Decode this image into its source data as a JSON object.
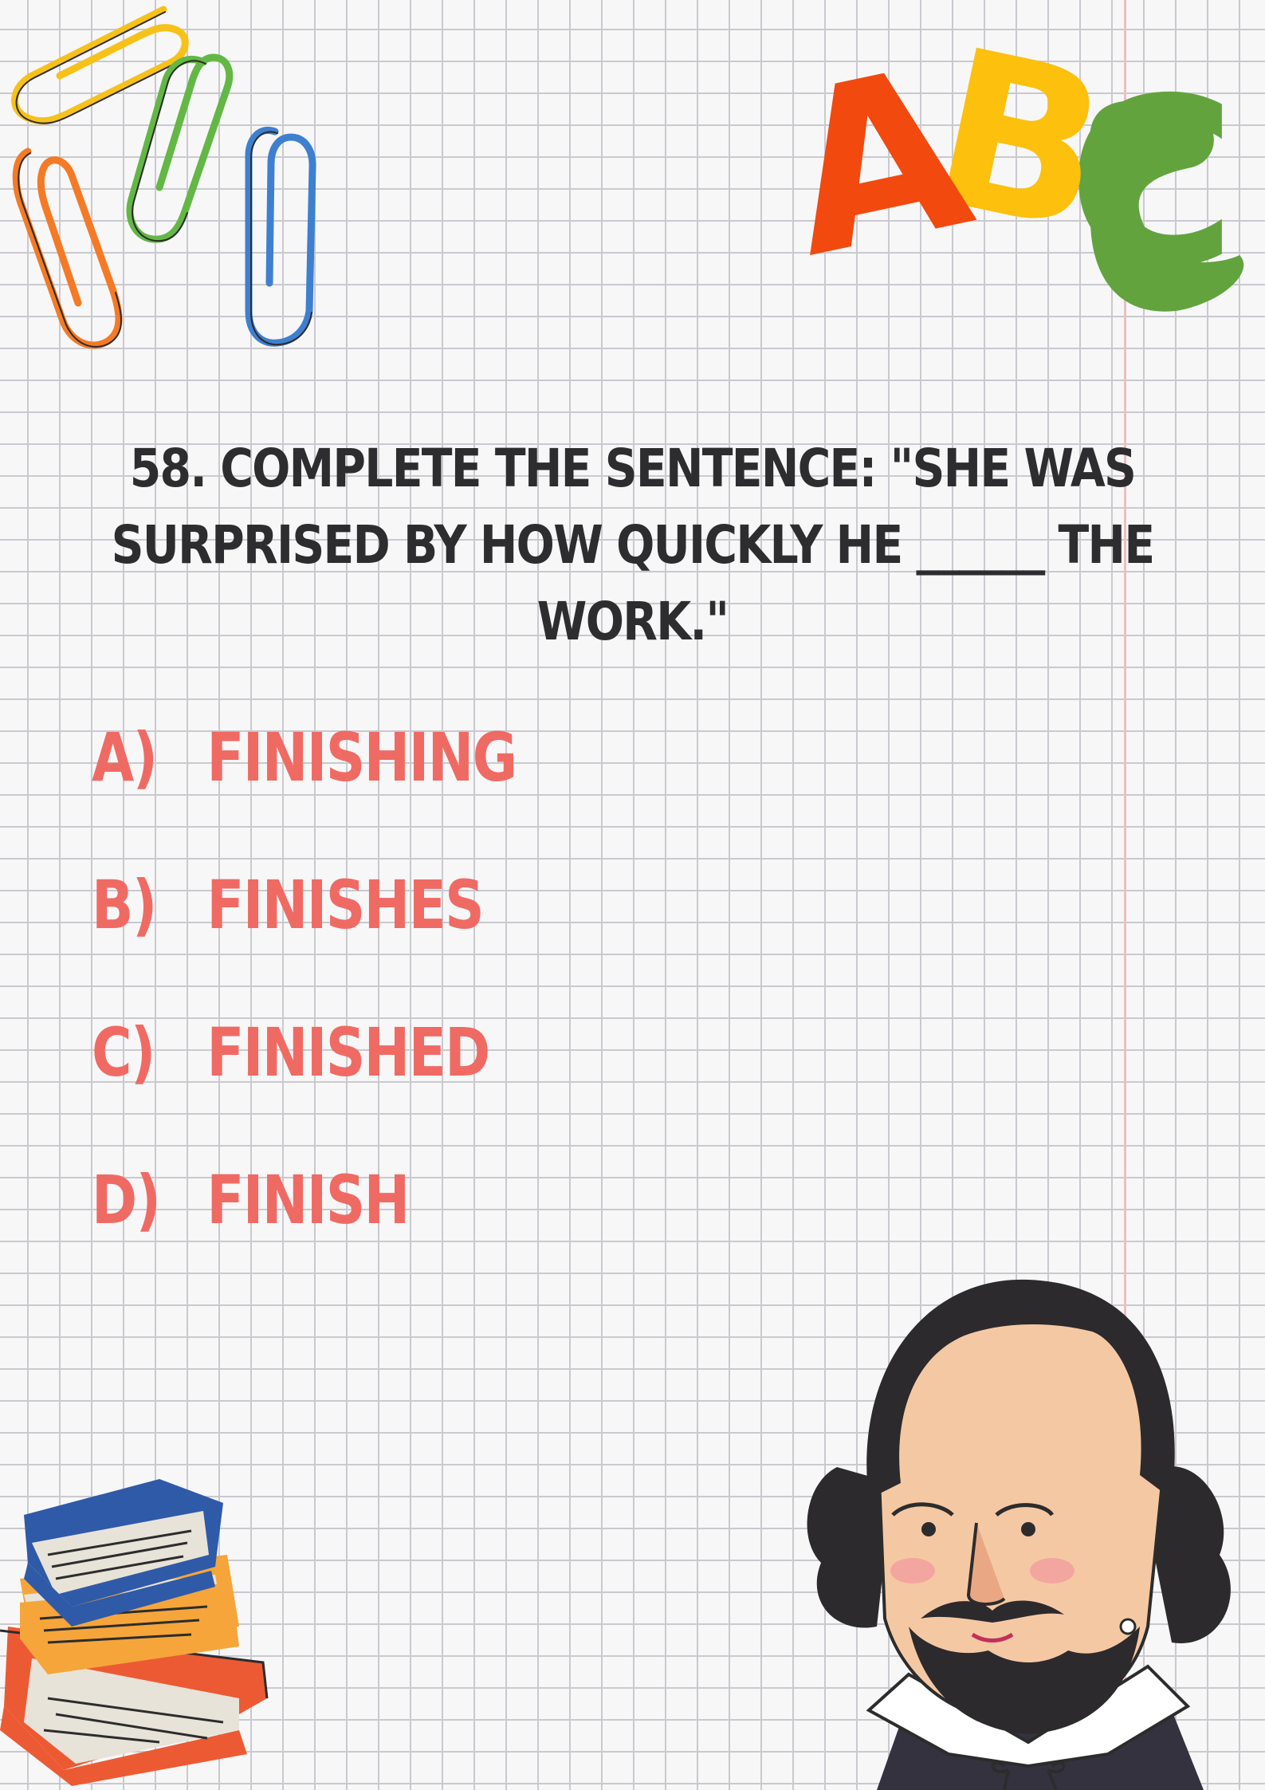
{
  "question": {
    "text": "58. Complete the sentence: \"She was surprised by how quickly he ______ the work.\""
  },
  "options": [
    {
      "letter": "A)",
      "text": "finishing"
    },
    {
      "letter": "B)",
      "text": "finishes"
    },
    {
      "letter": "C)",
      "text": "finished"
    },
    {
      "letter": "D)",
      "text": "finish"
    }
  ],
  "decorations": {
    "abc_letters": {
      "a": "A",
      "b": "B",
      "c": "C"
    },
    "abc_colors": {
      "a": "#f2490f",
      "b": "#fcc00d",
      "c": "#62a33e"
    },
    "paperclip_colors": [
      "#f6c21a",
      "#f47a26",
      "#63b745",
      "#3f7fcf"
    ],
    "book_colors": [
      "#2f5aa8",
      "#f5a53a",
      "#ec5a33"
    ],
    "icons": [
      "paperclip-icon",
      "abc-letters-icon",
      "book-stack-icon",
      "shakespeare-illustration"
    ]
  }
}
